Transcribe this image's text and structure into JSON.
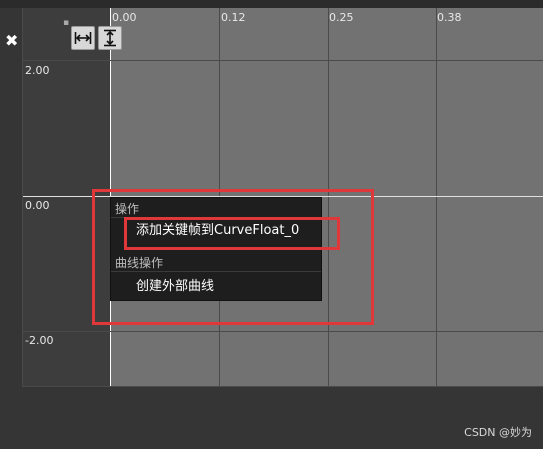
{
  "colors": {
    "graph_bg": "#727272",
    "left_band": "#3d3d3d",
    "menu_bg": "#1e1e1e",
    "annotation": "#e0373b"
  },
  "toolbar": {
    "close_icon": "close-icon",
    "fit_horizontal_icon": "fit-horizontal-icon",
    "fit_vertical_icon": "fit-vertical-icon"
  },
  "graph": {
    "x_ticks": [
      "0.00",
      "0.12",
      "0.25",
      "0.38"
    ],
    "y_ticks": [
      "2.00",
      "0.00",
      "-2.00"
    ]
  },
  "context_menu": {
    "sections": [
      {
        "header": "操作",
        "items": [
          "添加关键帧到CurveFloat_0"
        ]
      },
      {
        "header": "曲线操作",
        "items": [
          "创建外部曲线"
        ]
      }
    ]
  },
  "watermark": "CSDN @妙为"
}
